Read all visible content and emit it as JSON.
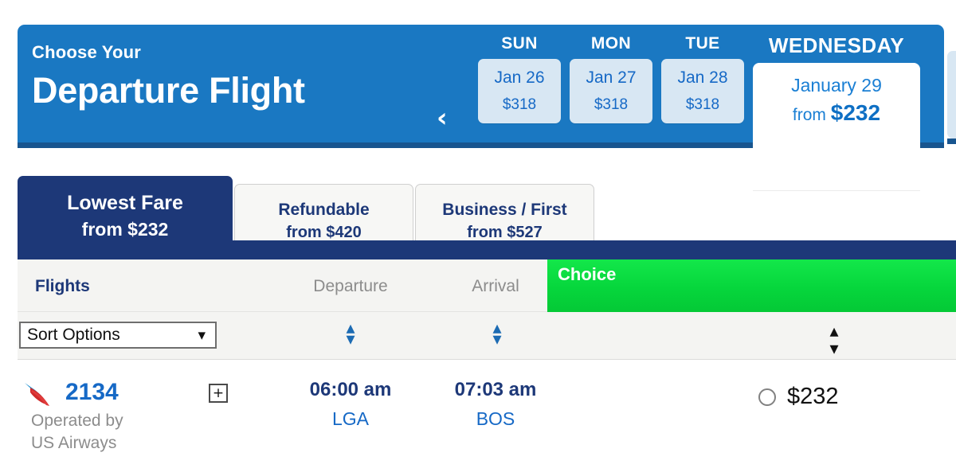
{
  "header": {
    "eyebrow": "Choose Your",
    "title": "Departure Flight",
    "prev_arrow_icon": "chevron-left-icon",
    "days": [
      {
        "dow": "SUN",
        "date": "Jan 26",
        "price": "$318",
        "active": false
      },
      {
        "dow": "MON",
        "date": "Jan 27",
        "price": "$318",
        "active": false
      },
      {
        "dow": "TUE",
        "date": "Jan 28",
        "price": "$318",
        "active": false
      },
      {
        "dow": "WEDNESDAY",
        "date": "January 29",
        "from_label": "from",
        "price": "$232",
        "active": true
      }
    ]
  },
  "fare_tabs": [
    {
      "label": "Lowest Fare",
      "sub": "from $232",
      "active": true
    },
    {
      "label": "Refundable",
      "sub": "from $420",
      "active": false
    },
    {
      "label": "Business / First",
      "sub": "from $527",
      "active": false
    }
  ],
  "table": {
    "columns": {
      "flights": "Flights",
      "departure": "Departure",
      "arrival": "Arrival",
      "choice": "Choice"
    },
    "sort": {
      "select_value": "Sort Options",
      "chevron_icon": "chevron-down-icon",
      "sorter_up": "▴",
      "sorter_down": "▾"
    },
    "rows": [
      {
        "airline_logo": "american-airlines-logo",
        "flight_number": "2134",
        "operated_by": "Operated by\nUS Airways",
        "expander_icon": "+",
        "departure_time": "06:00 am",
        "departure_airport": "LGA",
        "arrival_time": "07:03 am",
        "arrival_airport": "BOS",
        "price": "$232",
        "selected": false
      }
    ]
  },
  "colors": {
    "header_blue": "#1a78c2",
    "header_blue_dark": "#18558f",
    "navy": "#1d3878",
    "link_blue": "#1669c6",
    "choice_green": "#06d63c",
    "gray_text": "#8c8c8c"
  }
}
